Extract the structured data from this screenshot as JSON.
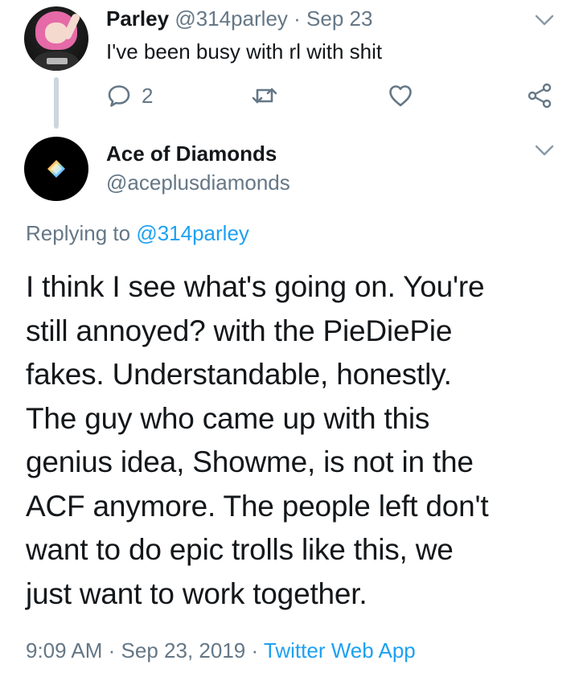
{
  "reply_tweet": {
    "name": "Parley",
    "handle": "@314parley",
    "separator": "·",
    "date": "Sep 23",
    "text": "I've been busy with rl with shit",
    "reply_count": "2"
  },
  "main_tweet": {
    "name": "Ace of Diamonds",
    "handle": "@aceplusdiamonds",
    "replying_prefix": "Replying to",
    "replying_to": "@314parley",
    "lines": [
      "I think I see what's going on. You're",
      "still annoyed? with the PieDiePie",
      "fakes. Understandable, honestly.",
      "The guy who came up with this",
      "genius idea, Showme, is not in the",
      "ACF anymore. The people left don't",
      "want to do epic trolls like this, we",
      "just want to work together."
    ],
    "time": "9:09 AM",
    "separator": "·",
    "date": "Sep 23, 2019",
    "source": "Twitter Web App"
  },
  "icons": {
    "reply": "reply-icon",
    "retweet": "retweet-icon",
    "like": "heart-icon",
    "share": "share-icon",
    "menu": "chevron-down-icon"
  },
  "colors": {
    "text": "#14171a",
    "secondary": "#657786",
    "link": "#1da1f2",
    "thread_line": "#ccd6dd"
  }
}
